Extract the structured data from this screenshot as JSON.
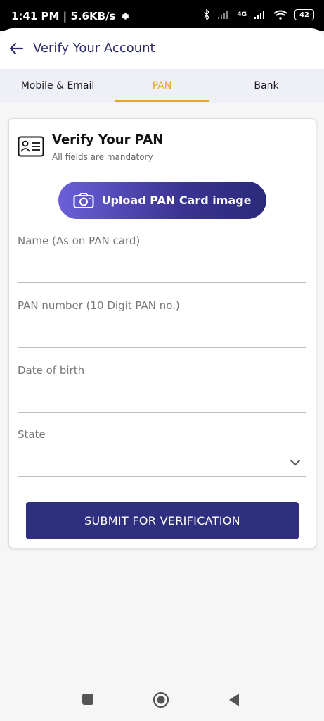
{
  "status_bar": {
    "time_speed": "1:41 PM | 5.6KB/s",
    "network": "4G",
    "battery": "42"
  },
  "header": {
    "title": "Verify Your Account",
    "back_icon": "arrow-left-icon"
  },
  "tabs": [
    {
      "label": "Mobile & Email",
      "active": false
    },
    {
      "label": "PAN",
      "active": true
    },
    {
      "label": "Bank",
      "active": false
    }
  ],
  "card": {
    "icon": "id-card-icon",
    "title": "Verify Your PAN",
    "subtitle": "All fields are mandatory",
    "upload_label": "Upload PAN Card image",
    "fields": [
      {
        "label": "Name (As on PAN card)",
        "value": ""
      },
      {
        "label": "PAN number (10 Digit PAN no.)",
        "value": ""
      },
      {
        "label": "Date of birth",
        "value": ""
      },
      {
        "label": "State",
        "value": "",
        "dropdown": true
      }
    ],
    "submit_label": "SUBMIT FOR VERIFICATION"
  },
  "colors": {
    "accent": "#e6a817",
    "primary": "#2f2f7f"
  }
}
